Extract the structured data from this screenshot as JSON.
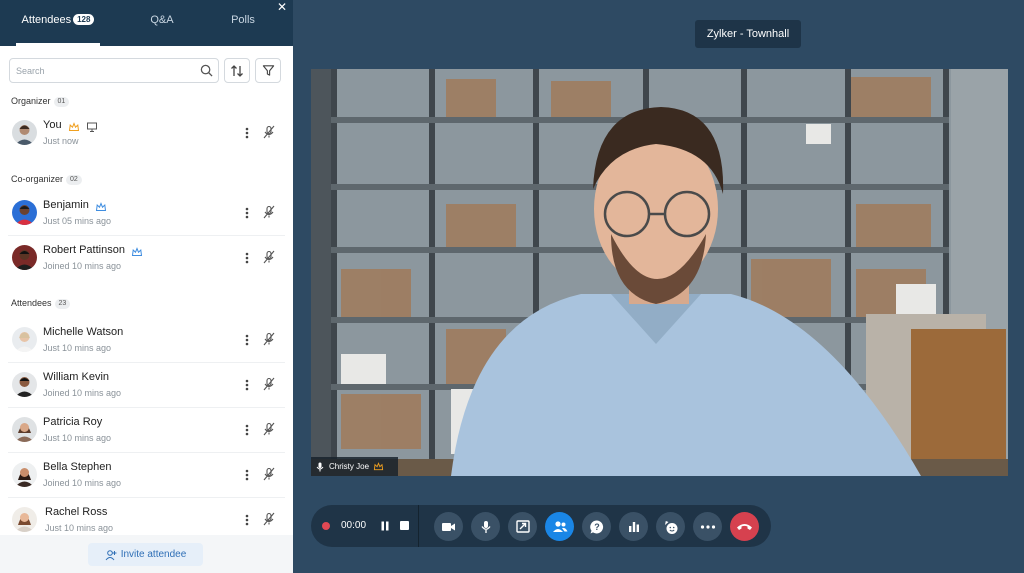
{
  "meeting": {
    "title": "Zylker - Townhall"
  },
  "tabs": [
    {
      "label": "Attendees",
      "count": "128"
    },
    {
      "label": "Q&A"
    },
    {
      "label": "Polls"
    }
  ],
  "search": {
    "placeholder": "Search"
  },
  "sections": {
    "organizer": {
      "label": "Organizer",
      "count": "01",
      "people": [
        {
          "name": "You",
          "status": "Just now"
        }
      ]
    },
    "coorganizer": {
      "label": "Co-organizer",
      "count": "02",
      "people": [
        {
          "name": "Benjamin",
          "status": "Just 05 mins ago"
        },
        {
          "name": "Robert Pattinson",
          "status": "Joined 10 mins ago"
        }
      ]
    },
    "attendees": {
      "label": "Attendees",
      "count": "23",
      "people": [
        {
          "name": "Michelle Watson",
          "status": "Just 10 mins ago"
        },
        {
          "name": "William Kevin",
          "status": "Joined 10 mins ago"
        },
        {
          "name": "Patricia Roy",
          "status": "Just 10 mins ago"
        },
        {
          "name": "Bella Stephen",
          "status": "Joined 10 mins ago"
        },
        {
          "name": "Rachel Ross",
          "status": "Just 10 mins ago"
        }
      ]
    }
  },
  "invite": {
    "label": "Invite attendee"
  },
  "video": {
    "speaker": "Christy Joe"
  },
  "recording": {
    "time": "00:00"
  },
  "colors": {
    "accent": "#1a86e6",
    "end_call": "#d6414f",
    "record": "#e04854",
    "panel_header": "#1d3a52",
    "stage": "#2e4a63"
  }
}
